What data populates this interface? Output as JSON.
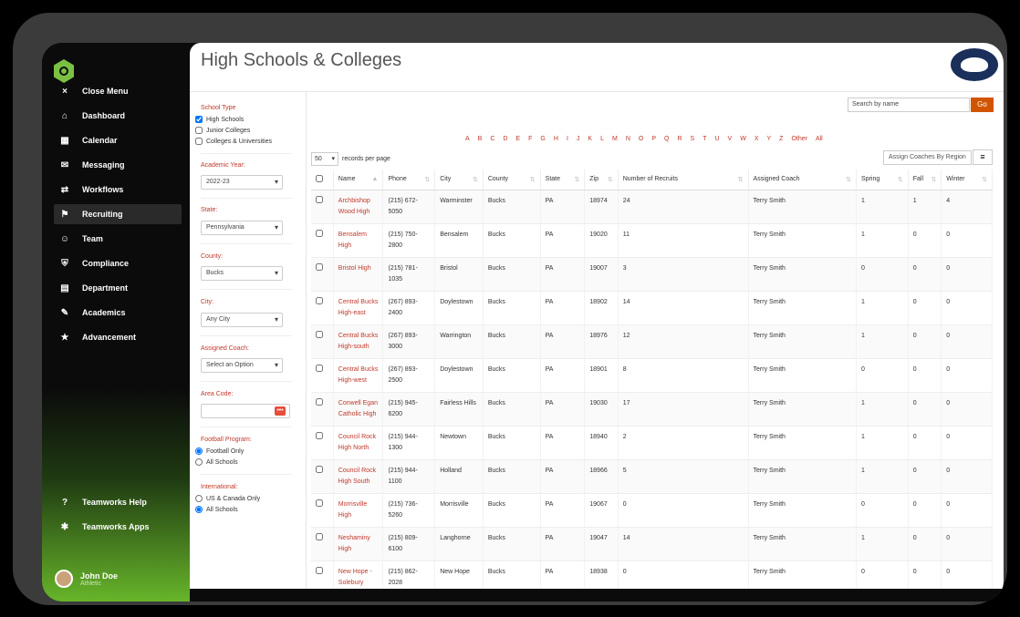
{
  "sidebar": {
    "items": [
      {
        "label": "Close Menu",
        "icon": "×"
      },
      {
        "label": "Dashboard",
        "icon": "⌂"
      },
      {
        "label": "Calendar",
        "icon": "▦"
      },
      {
        "label": "Messaging",
        "icon": "✉"
      },
      {
        "label": "Workflows",
        "icon": "⇄"
      },
      {
        "label": "Recruiting",
        "icon": "⚑"
      },
      {
        "label": "Team",
        "icon": "☺"
      },
      {
        "label": "Compliance",
        "icon": "⛨"
      },
      {
        "label": "Department",
        "icon": "▤"
      },
      {
        "label": "Academics",
        "icon": "✎"
      },
      {
        "label": "Advancement",
        "icon": "★"
      }
    ],
    "help": "Teamworks Help",
    "apps": "Teamworks Apps",
    "user": {
      "name": "John Doe",
      "role": "Athletic"
    }
  },
  "page": {
    "title": "High Schools & Colleges"
  },
  "filters": {
    "school_type_label": "School Type",
    "school_types": [
      "High Schools",
      "Junior Colleges",
      "Colleges & Universities"
    ],
    "academic_year_label": "Academic Year:",
    "academic_year": "2022-23",
    "state_label": "State:",
    "state": "Pennsylvania",
    "county_label": "County:",
    "county": "Bucks",
    "city_label": "City:",
    "city": "Any City",
    "coach_label": "Assigned Coach:",
    "coach": "Select an Option",
    "area_label": "Area Code:",
    "area_btn": "•••",
    "football_label": "Football Program:",
    "football_opts": [
      "Football Only",
      "All Schools"
    ],
    "intl_label": "International:",
    "intl_opts": [
      "US & Canada Only",
      "All Schools"
    ]
  },
  "search": {
    "placeholder": "Search by name",
    "go": "Go"
  },
  "alphabet": [
    "A",
    "B",
    "C",
    "D",
    "E",
    "F",
    "G",
    "H",
    "I",
    "J",
    "K",
    "L",
    "M",
    "N",
    "O",
    "P",
    "Q",
    "R",
    "S",
    "T",
    "U",
    "V",
    "W",
    "X",
    "Y",
    "Z",
    "Other",
    "All"
  ],
  "records": {
    "value": "50",
    "label": "records per page"
  },
  "assign_label": "Assign Coaches By Region",
  "menu_icon": "≡",
  "table": {
    "headers": [
      "Name",
      "Phone",
      "City",
      "County",
      "State",
      "Zip",
      "Number of Recruits",
      "Assigned Coach",
      "Spring",
      "Fall",
      "Winter"
    ],
    "rows": [
      [
        "Archbishop Wood High",
        "(215) 672-5050",
        "Warminster",
        "Bucks",
        "PA",
        "18974",
        "24",
        "Terry Smith",
        "1",
        "1",
        "4"
      ],
      [
        "Bensalem High",
        "(215) 750-2800",
        "Bensalem",
        "Bucks",
        "PA",
        "19020",
        "11",
        "Terry Smith",
        "1",
        "0",
        "0"
      ],
      [
        "Bristol High",
        "(215) 781-1035",
        "Bristol",
        "Bucks",
        "PA",
        "19007",
        "3",
        "Terry Smith",
        "0",
        "0",
        "0"
      ],
      [
        "Central Bucks High-east",
        "(267) 893-2400",
        "Doylestown",
        "Bucks",
        "PA",
        "18902",
        "14",
        "Terry Smith",
        "1",
        "0",
        "0"
      ],
      [
        "Central Bucks High-south",
        "(267) 893-3000",
        "Warrington",
        "Bucks",
        "PA",
        "18976",
        "12",
        "Terry Smith",
        "1",
        "0",
        "0"
      ],
      [
        "Central Bucks High-west",
        "(267) 893-2500",
        "Doylestown",
        "Bucks",
        "PA",
        "18901",
        "8",
        "Terry Smith",
        "0",
        "0",
        "0"
      ],
      [
        "Conwell Egan Catholic High",
        "(215) 945-6200",
        "Fairless Hills",
        "Bucks",
        "PA",
        "19030",
        "17",
        "Terry Smith",
        "1",
        "0",
        "0"
      ],
      [
        "Council Rock High North",
        "(215) 944-1300",
        "Newtown",
        "Bucks",
        "PA",
        "18940",
        "2",
        "Terry Smith",
        "1",
        "0",
        "0"
      ],
      [
        "Council Rock High South",
        "(215) 944-1100",
        "Holland",
        "Bucks",
        "PA",
        "18966",
        "5",
        "Terry Smith",
        "1",
        "0",
        "0"
      ],
      [
        "Morrisville High",
        "(215) 736-5260",
        "Morrisville",
        "Bucks",
        "PA",
        "19067",
        "0",
        "Terry Smith",
        "0",
        "0",
        "0"
      ],
      [
        "Neshaminy High",
        "(215) 809-6100",
        "Langhorne",
        "Bucks",
        "PA",
        "19047",
        "14",
        "Terry Smith",
        "1",
        "0",
        "0"
      ],
      [
        "New Hope - Solebury",
        "(215) 862-2028",
        "New Hope",
        "Bucks",
        "PA",
        "18938",
        "0",
        "Terry Smith",
        "0",
        "0",
        "0"
      ]
    ]
  }
}
